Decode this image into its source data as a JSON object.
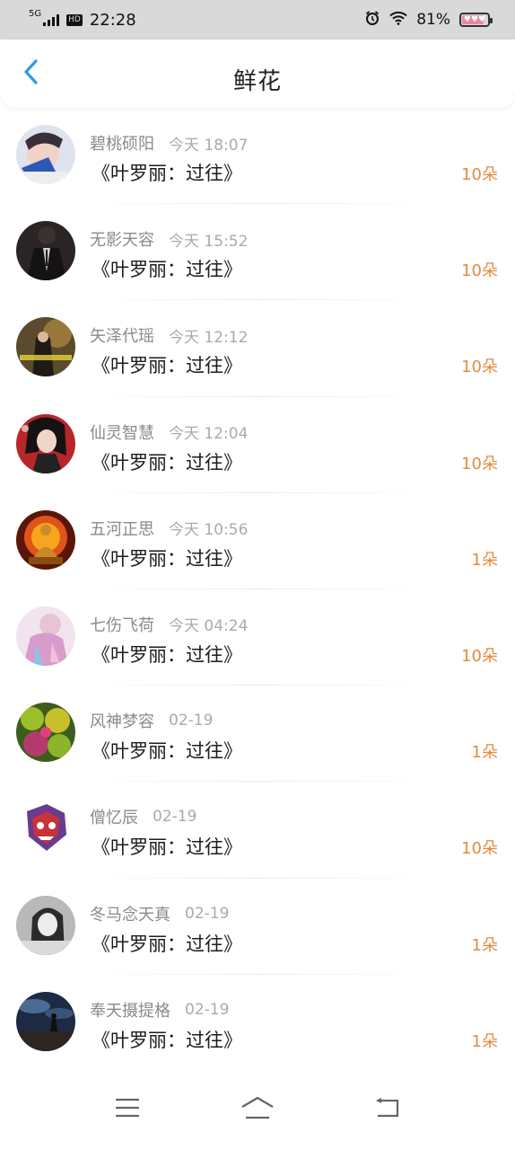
{
  "status_bar": {
    "network": "5G",
    "hd": "HD",
    "time": "22:28",
    "battery": "81%"
  },
  "header": {
    "title": "鲜花"
  },
  "items": [
    {
      "name": "碧桃硕阳",
      "time": "今天 18:07",
      "book": "《叶罗丽：过往》",
      "count": "10朵"
    },
    {
      "name": "无影天容",
      "time": "今天 15:52",
      "book": "《叶罗丽：过往》",
      "count": "10朵"
    },
    {
      "name": "矢泽代瑶",
      "time": "今天 12:12",
      "book": "《叶罗丽：过往》",
      "count": "10朵"
    },
    {
      "name": "仙灵智慧",
      "time": "今天 12:04",
      "book": "《叶罗丽：过往》",
      "count": "10朵"
    },
    {
      "name": "五河正思",
      "time": "今天 10:56",
      "book": "《叶罗丽：过往》",
      "count": "1朵"
    },
    {
      "name": "七伤飞荷",
      "time": "今天 04:24",
      "book": "《叶罗丽：过往》",
      "count": "10朵"
    },
    {
      "name": "风神梦容",
      "time": "02-19",
      "book": "《叶罗丽：过往》",
      "count": "1朵"
    },
    {
      "name": "僧忆辰",
      "time": "02-19",
      "book": "《叶罗丽：过往》",
      "count": "10朵"
    },
    {
      "name": "冬马念天真",
      "time": "02-19",
      "book": "《叶罗丽：过往》",
      "count": "1朵"
    },
    {
      "name": "奉天摄提格",
      "time": "02-19",
      "book": "《叶罗丽：过往》",
      "count": "1朵"
    }
  ],
  "colors": {
    "accent_blue": "#2f9be0",
    "count_orange": "#e58a3c"
  }
}
